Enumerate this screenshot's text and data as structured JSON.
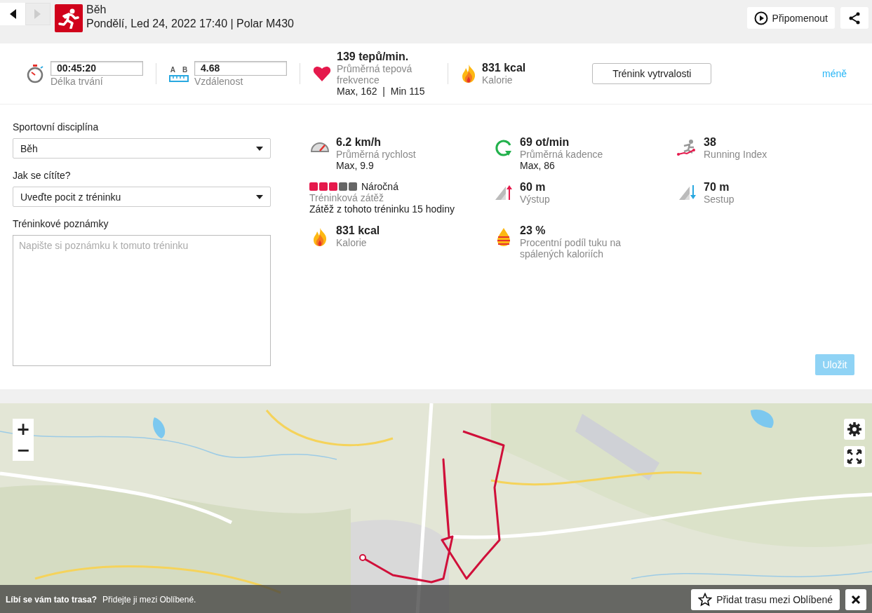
{
  "nav": {
    "back": {
      "disabled": false
    },
    "forward": {
      "disabled": true
    }
  },
  "header": {
    "title": "Běh",
    "subtitle": "Pondělí, Led 24, 2022 17:40 | Polar M430",
    "replay_button": "Připomenout"
  },
  "summary": {
    "duration": {
      "value": "00:45:20",
      "label": "Délka trvání"
    },
    "distance": {
      "value": "4.68",
      "label": "Vzdálenost",
      "point_a": "A",
      "point_b": "B"
    },
    "heart_rate": {
      "value": "139 tepů/min.",
      "label": "Průměrná tepová frekvence",
      "detail": "Max, 162  |  Min 115"
    },
    "calories": {
      "value": "831 kcal",
      "label": "Kalorie"
    },
    "benefit_button": "Trénink vytrvalosti",
    "less_link": "méně"
  },
  "form": {
    "sport": {
      "label": "Sportovní disciplína",
      "value": "Běh"
    },
    "feeling": {
      "label": "Jak se cítíte?",
      "value": "Uveďte pocit z tréninku"
    },
    "notes": {
      "label": "Tréninkové poznámky",
      "placeholder": "Napište si poznámku k tomuto tréninku"
    },
    "save_button": {
      "label": "Uložit",
      "disabled": true
    }
  },
  "stats": [
    {
      "kind": "speed",
      "value": "6.2 km/h",
      "label": "Průměrná rychlost",
      "detail": "Max, 9.9"
    },
    {
      "kind": "cadence",
      "value": "69 ot/min",
      "label": "Průměrná kadence",
      "detail": "Max, 86"
    },
    {
      "kind": "running_index",
      "value": "38",
      "label": "Running Index"
    },
    {
      "kind": "load",
      "stars": 3,
      "value": "Náročná",
      "label": "Tréninková zátěž",
      "detail": "Zátěž z tohoto tréninku 15 hodiny"
    },
    {
      "kind": "ascent",
      "value": "60 m",
      "label": "Výstup"
    },
    {
      "kind": "descent",
      "value": "70 m",
      "label": "Sestup"
    },
    {
      "kind": "calories",
      "value": "831 kcal",
      "label": "Kalorie"
    },
    {
      "kind": "fat",
      "value": "23 %",
      "label": "Procentní podíl tuku na spálených kaloriích"
    }
  ],
  "map": {
    "kind": "picture",
    "zoom_in": "+",
    "zoom_out": "−",
    "banner": {
      "question": "Líbí se vám tato trasa?",
      "text": "Přidejte ji mezi Oblíbené.",
      "favorite_button": "Přidat trasu mezi Oblíbené"
    }
  }
}
